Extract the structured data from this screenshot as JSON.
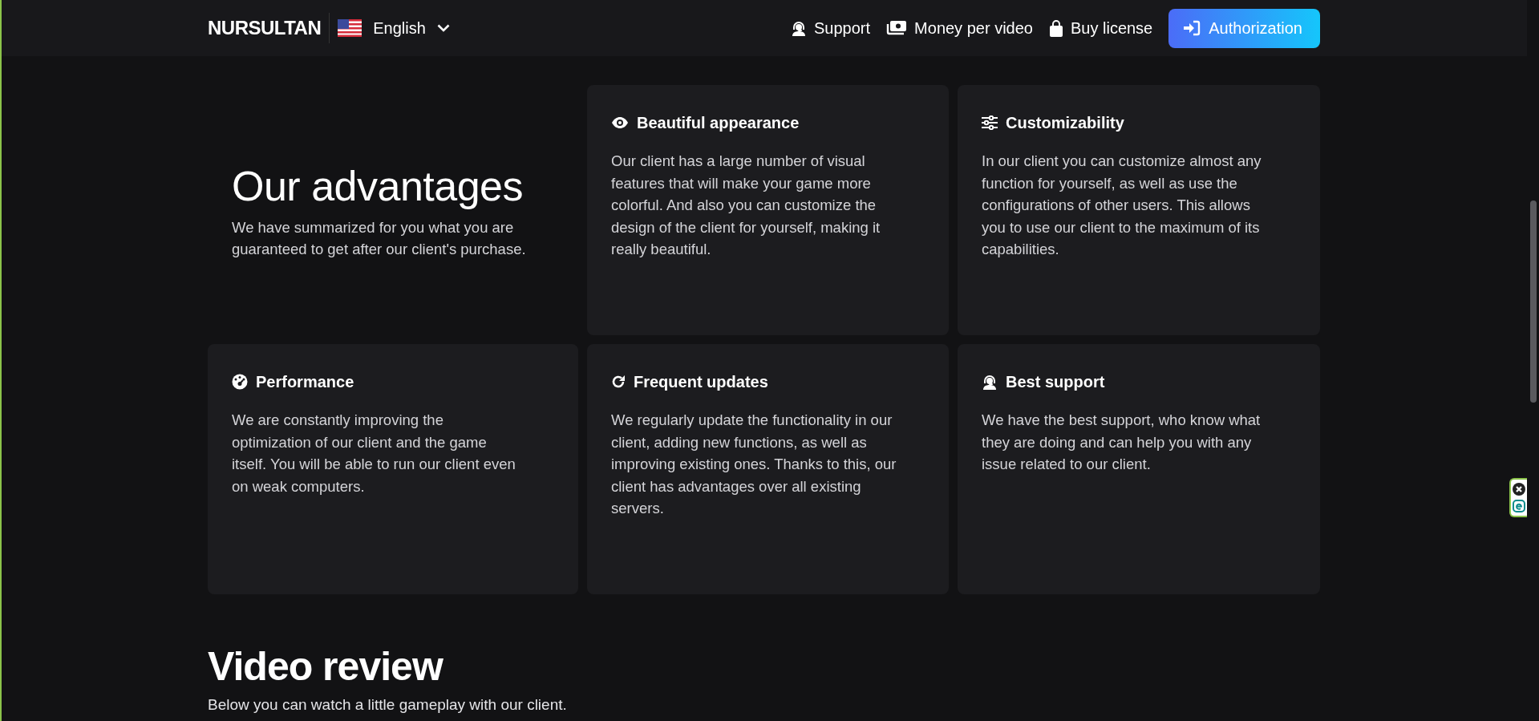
{
  "header": {
    "logo": "NURSULTAN",
    "language": {
      "label": "English"
    },
    "nav": [
      {
        "label": "Support"
      },
      {
        "label": "Money per video"
      },
      {
        "label": "Buy license"
      }
    ],
    "auth_button": {
      "label": "Authorization"
    }
  },
  "advantages": {
    "title": "Our advantages",
    "subtitle": "We have summarized for you what you are guaranteed to get after our client's purchase.",
    "cards": [
      {
        "title": "Beautiful appearance",
        "text": "Our client has a large number of visual features that will make your game more colorful. And also you can customize the design of the client for yourself, making it really beautiful."
      },
      {
        "title": "Customizability",
        "text": "In our client you can customize almost any function for yourself, as well as use the configurations of other users. This allows you to use our client to the maximum of its capabilities."
      },
      {
        "title": "Performance",
        "text": "We are constantly improving the optimization of our client and the game itself. You will be able to run our client even on weak computers."
      },
      {
        "title": "Frequent updates",
        "text": "We regularly update the functionality in our client, adding new functions, as well as improving existing ones. Thanks to this, our client has advantages over all existing servers."
      },
      {
        "title": "Best support",
        "text": "We have the best support, who know what they are doing and can help you with any issue related to our client."
      }
    ]
  },
  "video_review": {
    "title": "Video review",
    "subtitle": "Below you can watch a little gameplay with our client."
  }
}
